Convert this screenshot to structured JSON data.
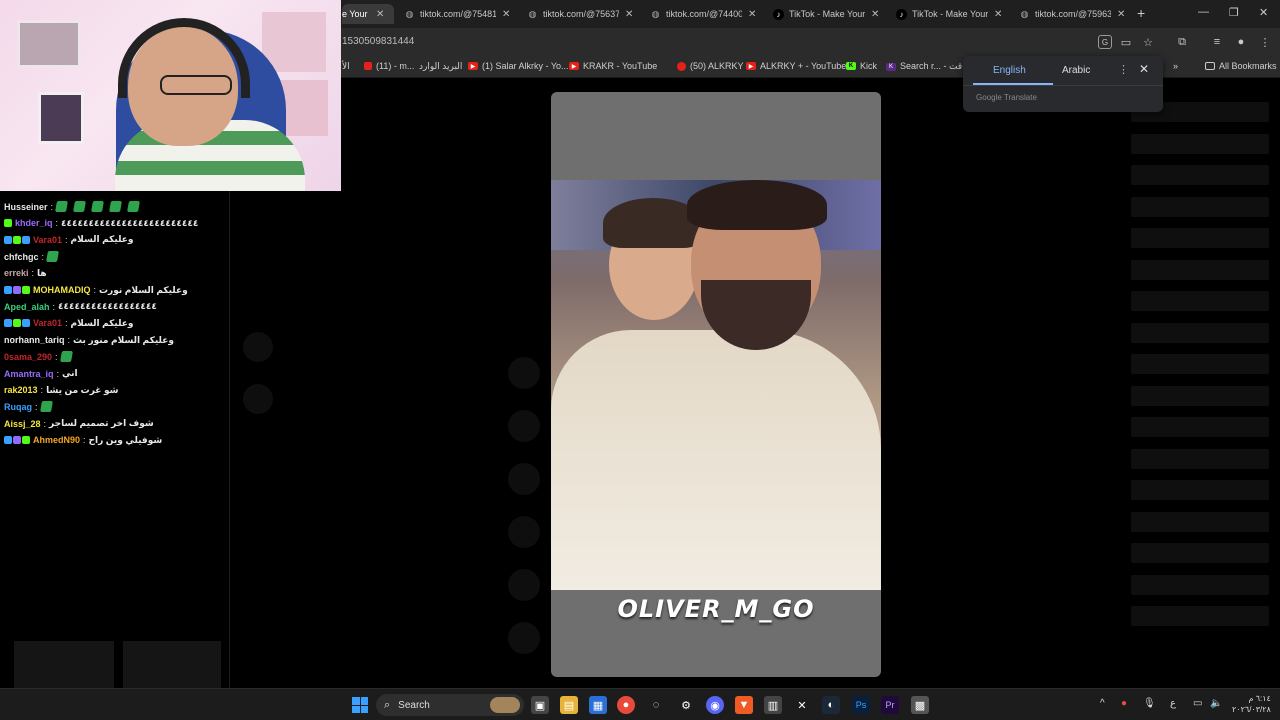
{
  "tabs": [
    {
      "label": "e Your",
      "active": true,
      "icon": "tiktok-icon"
    },
    {
      "label": "tiktok.com/@75481",
      "icon": "globe-icon"
    },
    {
      "label": "tiktok.com/@75637",
      "icon": "globe-icon"
    },
    {
      "label": "tiktok.com/@74400",
      "icon": "globe-icon"
    },
    {
      "label": "TikTok - Make Your D",
      "icon": "tiktok-icon"
    },
    {
      "label": "TikTok - Make Your D",
      "icon": "tiktok-icon"
    },
    {
      "label": "tiktok.com/@75963",
      "icon": "globe-icon"
    }
  ],
  "new_tab": "+",
  "window_controls": {
    "minimize": "—",
    "maximize": "❐",
    "close": "✕"
  },
  "address": {
    "url": "1530509831444"
  },
  "bookmarks": [
    {
      "label": "الأ"
    },
    {
      "label": "(11) - m..."
    },
    {
      "label": "البريد الوارد"
    },
    {
      "label": "(1) Salar Alkrky - Yo..."
    },
    {
      "label": "KRAKR - YouTube"
    },
    {
      "label": "(50) ALKRKY"
    },
    {
      "label": "ALKRKY + - YouTube"
    },
    {
      "label": "Kick"
    },
    {
      "label": "Search r... - ياقت"
    },
    {
      "label": "All Bookmarks"
    }
  ],
  "translate": {
    "lang_from": "English",
    "lang_to": "Arabic",
    "footer": "Google Translate",
    "more": "⋮",
    "close": "✕"
  },
  "chat": [
    {
      "user": "Husseiner",
      "color": "#e8e8e8",
      "text": "",
      "emotes": 5,
      "badges": []
    },
    {
      "user": "khder_iq",
      "color": "#9b6bff",
      "text": "٤٤٤٤٤٤٤٤٤٤٤٤٤٤٤٤٤٤٤٤٤٤٤٤٤",
      "badges": [
        "#53fc18"
      ]
    },
    {
      "user": "Vara01",
      "color": "#c0262d",
      "text": "وعليكم السلام",
      "badges": [
        "#3aa0ff",
        "#53fc18",
        "#3aa0ff"
      ]
    },
    {
      "user": "chfchgc",
      "color": "#e8e8e8",
      "text": "",
      "emotes": 1,
      "badges": []
    },
    {
      "user": "erreki",
      "color": "#c9a6a6",
      "text": "ها",
      "badges": []
    },
    {
      "user": "MOHAMADIQ",
      "color": "#f5e642",
      "text": "وعليكم السلام نورت",
      "badges": [
        "#3aa0ff",
        "#8f6bff",
        "#53fc18"
      ]
    },
    {
      "user": "Aped_alah",
      "color": "#38d07a",
      "text": "٤٤٤٤٤٤٤٤٤٤٤٤٤٤٤٤٤٤",
      "badges": []
    },
    {
      "user": "Vara01",
      "color": "#c0262d",
      "text": "وعليكم السلام",
      "badges": [
        "#3aa0ff",
        "#53fc18",
        "#3aa0ff"
      ]
    },
    {
      "user": "norhann_tariq",
      "color": "#e8e8e8",
      "text": "وعليكم السلام منور بث",
      "badges": []
    },
    {
      "user": "0sama_290",
      "color": "#c0262d",
      "text": "",
      "emotes": 1,
      "badges": []
    },
    {
      "user": "Amantra_iq",
      "color": "#9b6bff",
      "text": "اني",
      "badges": []
    },
    {
      "user": "rak2013",
      "color": "#f5e642",
      "text": "شو غرت من يشا",
      "badges": []
    },
    {
      "user": "Ruqag",
      "color": "#3aa0ff",
      "text": "",
      "emotes": 1,
      "badges": []
    },
    {
      "user": "Aissj_28",
      "color": "#f5e642",
      "text": "شوف اخر تصميم لساجر",
      "badges": []
    },
    {
      "user": "AhmedN90",
      "color": "#f5a623",
      "text": "شوفيلي وين راح",
      "badges": [
        "#3aa0ff",
        "#8f6bff",
        "#53fc18"
      ]
    }
  ],
  "video": {
    "caption": "OLIVER_M_GO"
  },
  "taskbar": {
    "search_label": "Search"
  },
  "clock": {
    "time": "٦:١٤ م",
    "date": "٢٠٢٦/٠٣/٢٨"
  }
}
